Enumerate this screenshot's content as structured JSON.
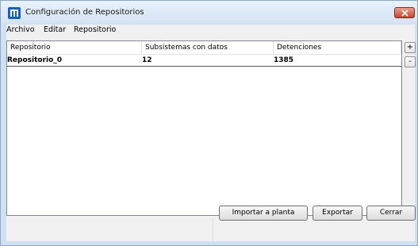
{
  "window": {
    "title": "Configuración de Repositorios",
    "close_label": "Close"
  },
  "menu": {
    "items": [
      "Archivo",
      "Editar",
      "Repositorio"
    ]
  },
  "table": {
    "columns": [
      "Repositorio",
      "Subsistemas con datos",
      "Detenciones"
    ],
    "rows": [
      [
        "Repositorio_0",
        "12",
        "1385"
      ]
    ]
  },
  "side_buttons": {
    "add": "+",
    "remove": "-"
  },
  "buttons": {
    "import": "Importar a planta",
    "export": "Exportar",
    "close": "Cerrar"
  },
  "colors": {
    "title_bar": "#d4e3f4",
    "close_button": "#c7452d",
    "app_icon": "#1560b8"
  }
}
